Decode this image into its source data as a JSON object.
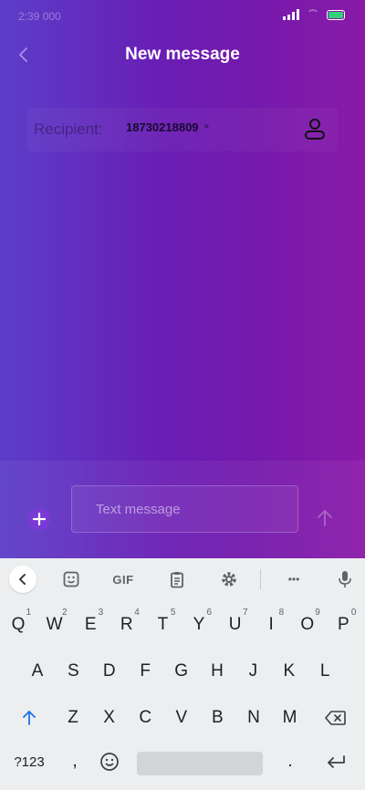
{
  "status": {
    "time": "2:39 000",
    "battery_color": "#33d17a"
  },
  "header": {
    "title": "New message",
    "back_icon": "chevron-left-icon"
  },
  "recipient": {
    "label": "Recipient:",
    "chip": "18730218809",
    "chip_remove": "×",
    "contact_icon": "person-icon"
  },
  "composer": {
    "placeholder": "Text message",
    "add_icon": "plus-icon",
    "send_icon": "arrow-up-icon"
  },
  "keyboard": {
    "toolbar": {
      "gif": "GIF",
      "more": "•••"
    },
    "row1": [
      {
        "k": "Q",
        "n": "1"
      },
      {
        "k": "W",
        "n": "2"
      },
      {
        "k": "E",
        "n": "3"
      },
      {
        "k": "R",
        "n": "4"
      },
      {
        "k": "T",
        "n": "5"
      },
      {
        "k": "Y",
        "n": "6"
      },
      {
        "k": "U",
        "n": "7"
      },
      {
        "k": "I",
        "n": "8"
      },
      {
        "k": "O",
        "n": "9"
      },
      {
        "k": "P",
        "n": "0"
      }
    ],
    "row2": [
      "A",
      "S",
      "D",
      "F",
      "G",
      "H",
      "J",
      "K",
      "L"
    ],
    "row3": [
      "Z",
      "X",
      "C",
      "V",
      "B",
      "N",
      "M"
    ],
    "symbols": "?123",
    "comma": ",",
    "period": "."
  }
}
